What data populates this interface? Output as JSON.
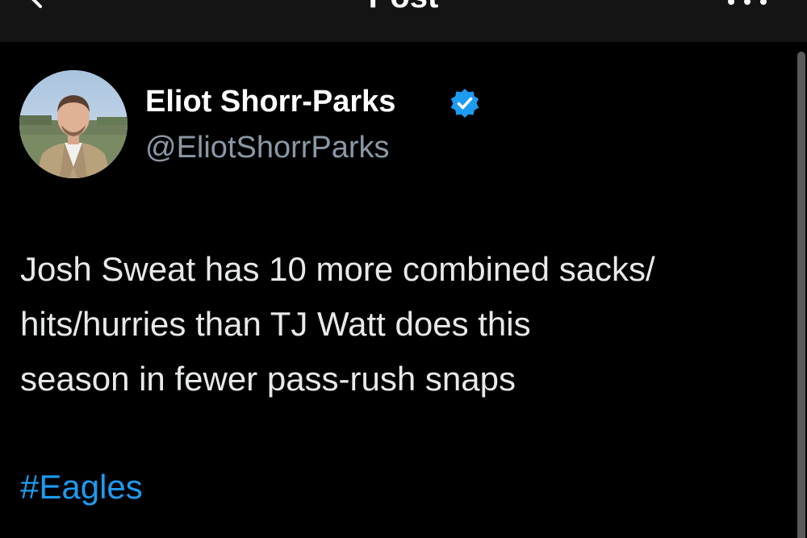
{
  "header": {
    "title": "Post",
    "back_icon": "chevron-left-icon",
    "more_icon": "more-horizontal-icon"
  },
  "author": {
    "name": "Eliot Shorr-Parks",
    "handle": "@EliotShorrParks",
    "verified_icon": "verified-badge-icon",
    "verified_color": "#1d9bf0"
  },
  "post": {
    "lines": [
      "Josh Sweat has 10 more combined sacks/",
      "hits/hurries than TJ Watt does this",
      "season in fewer pass-rush snaps"
    ],
    "hashtag": "#Eagles"
  },
  "colors": {
    "background": "#000000",
    "header_bg": "#141414",
    "text": "#e7e9ea",
    "secondary_text": "#8b98a5",
    "link": "#1d9bf0"
  }
}
